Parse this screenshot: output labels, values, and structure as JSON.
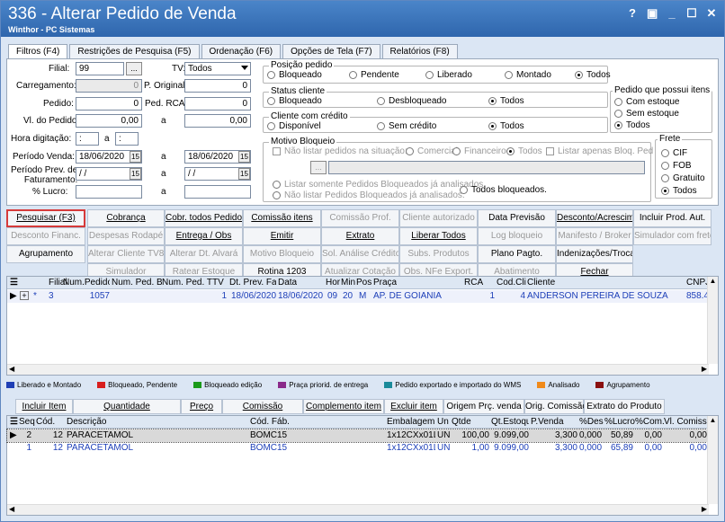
{
  "window": {
    "title": "336 - Alterar Pedido de Venda",
    "subtitle": "Winthor - PC Sistemas",
    "controls": [
      "?",
      "▣",
      "_",
      "☐",
      "✕"
    ]
  },
  "tabs": [
    "Filtros (F4)",
    "Restrições de Pesquisa (F5)",
    "Ordenação (F6)",
    "Opções de Tela (F7)",
    "Relatórios (F8)"
  ],
  "filters": {
    "filial_label": "Filial:",
    "filial_value": "99",
    "filial_btn": "...",
    "tv_label": "TV:",
    "tv_value": "Todos",
    "carregamento_label": "Carregamento:",
    "carregamento_value": "0",
    "p_original_label": "P. Original:",
    "p_original_value": "0",
    "pedido_label": "Pedido:",
    "pedido_value": "0",
    "ped_rca_label": "Ped. RCA:",
    "ped_rca_value": "0",
    "vl_pedido_label": "Vl. do Pedido:",
    "vl_pedido_from": "0,00",
    "a1": "a",
    "vl_pedido_to": "0,00",
    "hora_label": "Hora digitação:",
    "hora_from": ":",
    "hora_a": "a",
    "hora_to": ":",
    "periodo_label": "Período Venda:",
    "periodo_from": "18/06/2020",
    "a2": "a",
    "periodo_to": "18/06/2020",
    "cal": "15",
    "prev_label1": "Período Prev. de",
    "prev_label2": "Faturamento:",
    "prev_from": "/ /",
    "a3": "a",
    "prev_to": "/ /",
    "lucro_label": "% Lucro:",
    "a4": "a"
  },
  "posicao": {
    "title": "Posição pedido",
    "options": [
      "Bloqueado",
      "Pendente",
      "Liberado",
      "Montado",
      "Todos"
    ]
  },
  "status": {
    "title": "Status cliente",
    "options": [
      "Bloqueado",
      "Desbloqueado",
      "Todos"
    ]
  },
  "credito": {
    "title": "Cliente com crédito",
    "options": [
      "Disponível",
      "Sem crédito",
      "Todos"
    ]
  },
  "itens": {
    "title": "Pedido que possui itens",
    "options": [
      "Com estoque",
      "Sem estoque",
      "Todos"
    ]
  },
  "motivo": {
    "title": "Motivo Bloqueio",
    "nao_listar": "Não listar pedidos na situação:",
    "comercial": "Comercial",
    "financeiro": "Financeiro",
    "todos": "Todos",
    "listar_apenas": "Listar apenas Bloq. Ped",
    "btn": "...",
    "opt1": "Listar somente Pedidos Bloqueados já analisados.",
    "opt2": "Não listar Pedidos Bloqueados já analisados.",
    "opt3": "Todos bloqueados."
  },
  "frete": {
    "title": "Frete",
    "options": [
      "CIF",
      "FOB",
      "Gratuito",
      "Todos"
    ]
  },
  "buttons": {
    "r1": [
      "Pesquisar (F3)",
      "Cobrança",
      "Cobr. todos Pedidos",
      "Comissão itens",
      "Comissão Prof.",
      "Cliente autorizado",
      "Data Previsão",
      "Desconto/Acrescimo",
      "Incluir Prod. Aut."
    ],
    "r2": [
      "Desconto Financ.",
      "Despesas Rodapé",
      "Entrega / Obs",
      "Emitir",
      "Extrato",
      "Liberar Todos",
      "Log bloqueio",
      "Manifesto / Broker",
      "Simulador com frete"
    ],
    "r3": [
      "Agrupamento",
      "Alterar Cliente TV8",
      "Alterar Dt. Alvará",
      "Motivo Bloqueio",
      "Sol. Análise Crédito",
      "Subs. Produtos",
      "Plano Pagto.",
      "Indenizações/Troca"
    ],
    "r4": [
      "Simulador",
      "Ratear Estoque",
      "Rotina 1203",
      "Atualizar Cotação",
      "Obs. NFe Export.",
      "Abatimento",
      "Fechar"
    ]
  },
  "grid1": {
    "headers": [
      "Filial",
      "Num.Pedido",
      "Num. Ped. B",
      "Num. Ped. T",
      "TV",
      "Dt. Prev. Fa",
      "Data",
      "Hor",
      "Min",
      "Pos",
      "Praça",
      "RCA",
      "Cod.Cli",
      "Cliente",
      "CNPJ"
    ],
    "row": {
      "marker": "*",
      "filial": "3",
      "num_pedido": "1057",
      "tv": "1",
      "dt_prev": "18/06/2020",
      "data": "18/06/2020",
      "hor": "09",
      "min": "20",
      "pos": "M",
      "praca": "AP. DE GOIANIA",
      "rca": "1",
      "cod_cli": "4",
      "cliente": "ANDERSON PEREIRA DE SOUZA",
      "cnpj": "858.4"
    }
  },
  "legend": [
    {
      "label": "Liberado e Montado",
      "color": "#1f3fb5"
    },
    {
      "label": "Bloqueado, Pendente",
      "color": "#d81e1e"
    },
    {
      "label": "Bloqueado edição",
      "color": "#1a9a1a"
    },
    {
      "label": "Praça priorid. de entrega",
      "color": "#8a2a8a"
    },
    {
      "label": "Pedido exportado e importado do WMS",
      "color": "#1a8a9a"
    },
    {
      "label": "Analisado",
      "color": "#f08a1a"
    },
    {
      "label": "Agrupamento",
      "color": "#8a1010"
    }
  ],
  "buttons2": [
    "Incluir Item",
    "Quantidade",
    "Preço",
    "Comissão",
    "Complemento item",
    "Excluir item",
    "Origem Prç. venda",
    "Orig. Comissão",
    "Extrato do Produto"
  ],
  "grid2": {
    "headers": [
      "Seq",
      "Cód.",
      "Descrição",
      "Cód. Fáb.",
      "Embalagem",
      "Un",
      "Qtde",
      "Qt.Estoque",
      "P.Venda",
      "%Des",
      "%Lucro",
      "%Com.",
      "Vl. Comissão"
    ],
    "rows": [
      {
        "seq": "2",
        "cod": "12",
        "desc": "PARACETAMOL",
        "fab": "BOMC15",
        "emb": "1x12CXx01L",
        "un": "UN",
        "qtde": "100,00",
        "qtest": "9.099,00",
        "pv": "3,300",
        "des": "0,000",
        "lucro": "50,89",
        "com": "0,00",
        "vlcom": "0,00"
      },
      {
        "seq": "1",
        "cod": "12",
        "desc": "PARACETAMOL",
        "fab": "BOMC15",
        "emb": "1x12CXx01L",
        "un": "UN",
        "qtde": "1,00",
        "qtest": "9.099,00",
        "pv": "3,300",
        "des": "0,000",
        "lucro": "65,89",
        "com": "0,00",
        "vlcom": "0,00"
      }
    ]
  }
}
